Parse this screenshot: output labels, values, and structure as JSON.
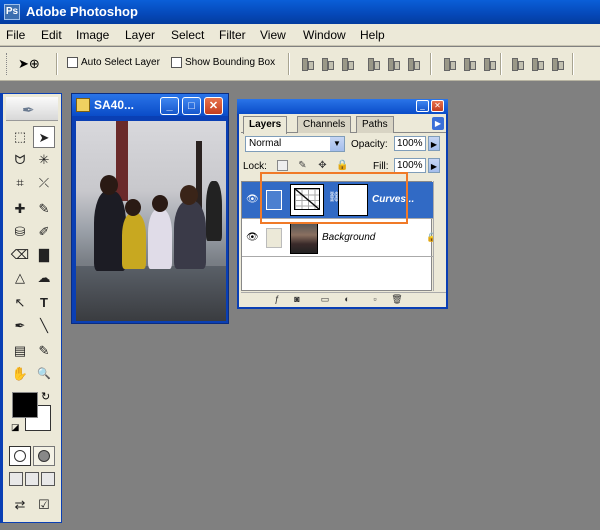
{
  "app": {
    "title": "Adobe Photoshop",
    "icon_text": "Ps"
  },
  "menu": [
    "File",
    "Edit",
    "Image",
    "Layer",
    "Select",
    "Filter",
    "View",
    "Window",
    "Help"
  ],
  "options": {
    "tool_glyph": "➤⊕",
    "auto_select_label": "Auto Select Layer",
    "auto_select_checked": false,
    "bounding_box_label": "Show Bounding Box",
    "bounding_box_checked": false
  },
  "toolbox": {
    "tools": [
      "⬚",
      "➤",
      "ᗢ",
      "✳",
      "⌗",
      "⤫",
      "✚",
      "✎",
      "⛁",
      "✐",
      "⌫",
      "▇",
      "△",
      "☁",
      "↖",
      "T",
      "✒",
      "╲",
      "▤",
      "✎",
      "✋",
      "🔍"
    ],
    "active_tool_index": 1,
    "fg_color": "#000000",
    "bg_color": "#ffffff"
  },
  "document": {
    "name": "SA40...",
    "buttons": {
      "minimize": "_",
      "maximize": "□",
      "close": "✕"
    }
  },
  "layers_panel": {
    "tabs": [
      "Layers",
      "Channels",
      "Paths"
    ],
    "active_tab": "Layers",
    "blend_mode": "Normal",
    "opacity_label": "Opacity:",
    "opacity": "100%",
    "lock_label": "Lock:",
    "fill_label": "Fill:",
    "fill": "100%",
    "layers": [
      {
        "name": "Curves...",
        "selected": true,
        "type": "adjustment"
      },
      {
        "name": "Background",
        "selected": false,
        "type": "image",
        "locked": true
      }
    ]
  },
  "colors": {
    "xp_blue": "#0a3fb4",
    "selection": "#316ac5",
    "highlight": "#f07a28",
    "workspace": "#808080"
  }
}
